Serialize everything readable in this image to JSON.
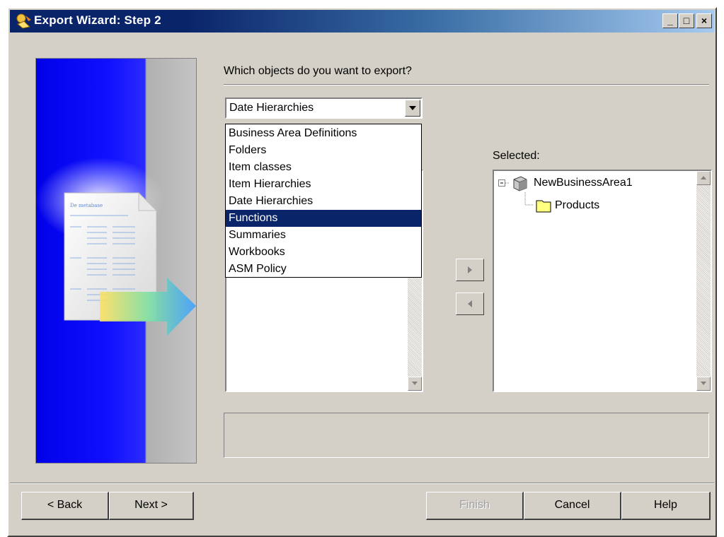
{
  "window": {
    "title": "Export Wizard: Step 2",
    "icon": "wizard-icon",
    "controls": {
      "minimize": "_",
      "maximize": "□",
      "close": "×"
    }
  },
  "banner": {
    "doc_heading": "De metabase",
    "icon": "document-export-illustration"
  },
  "main": {
    "prompt": "Which objects do you want to export?",
    "object_type_combo": {
      "value": "Date Hierarchies",
      "options": [
        "Business Area Definitions",
        "Folders",
        "Item classes",
        "Item Hierarchies",
        "Date Hierarchies",
        "Functions",
        "Summaries",
        "Workbooks",
        "ASM Policy"
      ],
      "highlighted": "Functions"
    },
    "selected_label": "Selected:",
    "selected_tree": [
      {
        "label": "NewBusinessArea1",
        "icon": "business-area-icon",
        "expanded": true
      },
      {
        "label": "Products",
        "icon": "folder-icon"
      }
    ]
  },
  "buttons": {
    "back": "< Back",
    "next": "Next >",
    "finish": "Finish",
    "cancel": "Cancel",
    "help": "Help"
  },
  "colors": {
    "title_bar": "#0a246a",
    "face": "#d4d0c8",
    "selection": "#0a246a",
    "banner_blue": "#0000e8"
  }
}
